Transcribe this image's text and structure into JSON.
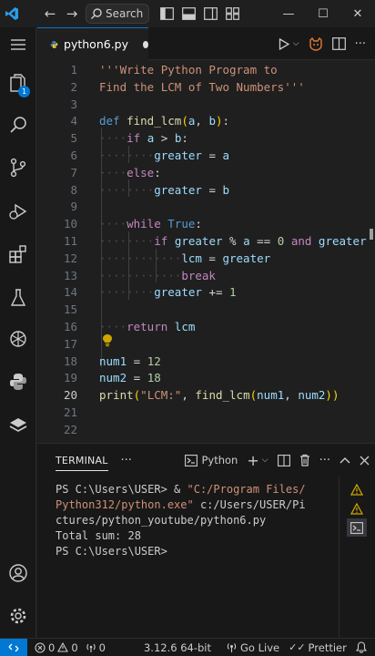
{
  "titlebar": {
    "search_label": "Search",
    "icons": [
      "vscode-logo",
      "back-arrow-icon",
      "forward-arrow-icon",
      "search-icon",
      "toggle-primary-sidebar-icon",
      "toggle-panel-icon",
      "toggle-secondary-sidebar-icon",
      "customize-layout-icon"
    ],
    "window_controls": [
      "minimize",
      "maximize",
      "close"
    ]
  },
  "activity": {
    "items": [
      "menu",
      "explorer",
      "search",
      "source-control",
      "run-and-debug",
      "extensions",
      "testing",
      "openai",
      "python",
      "stack"
    ],
    "explorer_badge": "1",
    "bottom": [
      "accounts",
      "manage"
    ]
  },
  "tab": {
    "filename": "python6.py",
    "modified": true
  },
  "editor": {
    "active_line": "20",
    "lines": [
      {
        "n": "1",
        "t": "'''Write Python Program to"
      },
      {
        "n": "2",
        "t": "Find the LCM of Two Numbers'''"
      },
      {
        "n": "3",
        "t": ""
      },
      {
        "n": "4",
        "t": "def find_lcm(a, b):"
      },
      {
        "n": "5",
        "t": "    if a > b:"
      },
      {
        "n": "6",
        "t": "        greater = a"
      },
      {
        "n": "7",
        "t": "    else:"
      },
      {
        "n": "8",
        "t": "        greater = b"
      },
      {
        "n": "9",
        "t": ""
      },
      {
        "n": "10",
        "t": "    while True:"
      },
      {
        "n": "11",
        "t": "        if greater % a == 0 and greater"
      },
      {
        "n": "12",
        "t": "            lcm = greater"
      },
      {
        "n": "13",
        "t": "            break"
      },
      {
        "n": "14",
        "t": "        greater += 1"
      },
      {
        "n": "15",
        "t": ""
      },
      {
        "n": "16",
        "t": "    return lcm"
      },
      {
        "n": "17",
        "t": ""
      },
      {
        "n": "18",
        "t": "num1 = 12"
      },
      {
        "n": "19",
        "t": "num2 = 18"
      },
      {
        "n": "20",
        "t": "print(\"LCM:\", find_lcm(num1, num2))"
      },
      {
        "n": "21",
        "t": ""
      },
      {
        "n": "22",
        "t": ""
      }
    ]
  },
  "panel": {
    "title": "TERMINAL",
    "more": "···",
    "shell_label": "Python",
    "terminal_lines": [
      {
        "prompt": "PS C:\\Users\\USER> & ",
        "path": "\"C:/Program Files/"
      },
      {
        "prompt": "",
        "path": "Python312/python.exe\"",
        "rest": " c:/Users/USER/Pi"
      },
      {
        "prompt": "",
        "path": "",
        "rest": "ctures/python_youtube/python6.py"
      },
      {
        "prompt": "Total sum: 28",
        "path": ""
      },
      {
        "prompt": "PS C:\\Users\\USER>",
        "path": ""
      }
    ]
  },
  "status": {
    "errors": "0",
    "warnings": "0",
    "ports": "0",
    "interpreter": "3.12.6 64-bit",
    "golive": "Go Live",
    "prettier": "Prettier"
  },
  "colors": {
    "accent": "#0078d4",
    "keyword": "#569cd6",
    "control": "#c586c0",
    "function": "#dcdcaa",
    "string": "#ce9178",
    "number": "#b5cea8",
    "variable": "#9cdcfe",
    "warning": "#cca700"
  }
}
